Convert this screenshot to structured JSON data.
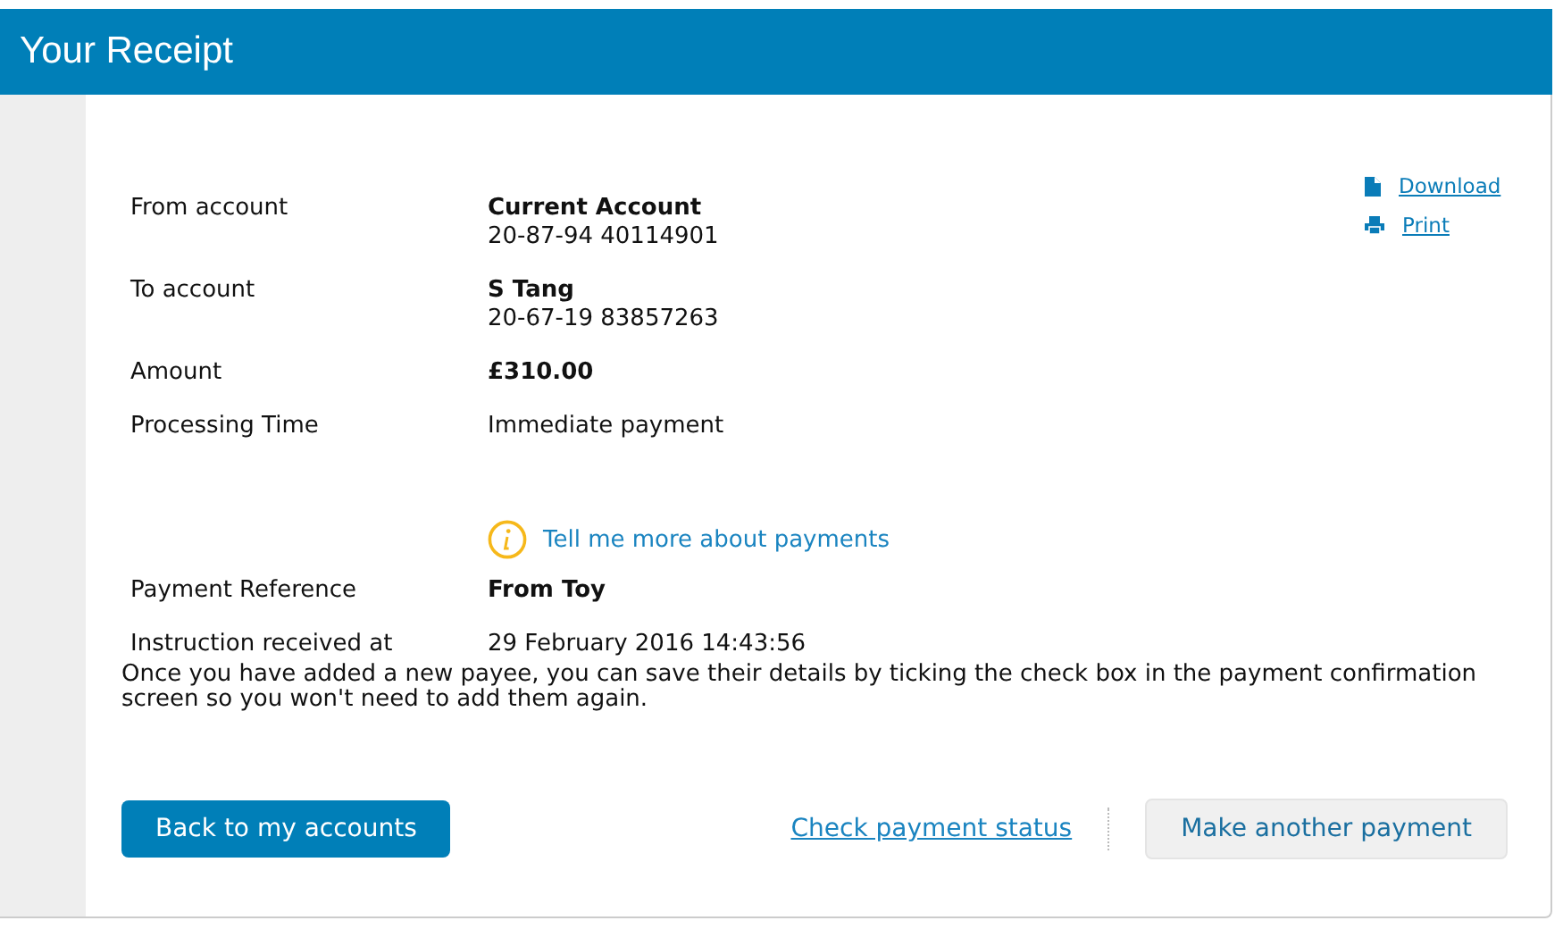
{
  "header": {
    "title": "Your Receipt"
  },
  "links": [
    {
      "kind": "download",
      "label": "Download"
    },
    {
      "kind": "print",
      "label": "Print"
    }
  ],
  "details": [
    {
      "label": "From account",
      "value": "Current Account",
      "detail": "20-87-94 40114901",
      "bold": true
    },
    {
      "label": "To account",
      "value": "S Tang",
      "detail": "20-67-19 83857263",
      "bold": true
    },
    {
      "label": "Amount",
      "value": "£310.00",
      "bold": true
    },
    {
      "label": "Processing Time",
      "value": "Immediate payment",
      "bold": false
    }
  ],
  "info_link": "Tell me more about payments",
  "details_after": [
    {
      "label": "Payment Reference",
      "value": "From Toy",
      "bold": true
    },
    {
      "label": "Instruction received at",
      "value": "29 February 2016 14:43:56",
      "bold": false
    }
  ],
  "note": "Once you have added a new payee, you can save their details by ticking the check box in the payment confirmation screen so you won't need to add them again.",
  "actions": {
    "primary": "Back to my accounts",
    "link": "Check payment status",
    "secondary": "Make another payment"
  }
}
